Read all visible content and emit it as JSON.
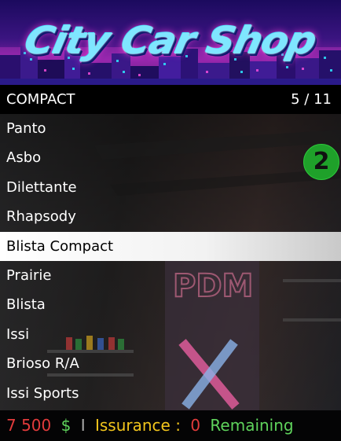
{
  "banner": {
    "logo_text": "City Car Shop"
  },
  "menu": {
    "category": "COMPACT",
    "counter": "5 / 11",
    "items": [
      "Panto",
      "Asbo",
      "Dilettante",
      "Rhapsody",
      "Blista Compact",
      "Prairie",
      "Blista",
      "Issi",
      "Brioso R/A",
      "Issi Sports"
    ],
    "selected_index": 4
  },
  "badge": {
    "number": "2",
    "color": "#1fa12a"
  },
  "footer": {
    "price": "7 500",
    "currency": "$",
    "separator": "I",
    "label": "Issurance :",
    "count": "0",
    "remaining": "Remaining"
  },
  "colors": {
    "price_red": "#e23b3b",
    "currency_green": "#5fd35c",
    "label_yellow": "#f2c51c",
    "selected_bg": "#ffffff"
  }
}
